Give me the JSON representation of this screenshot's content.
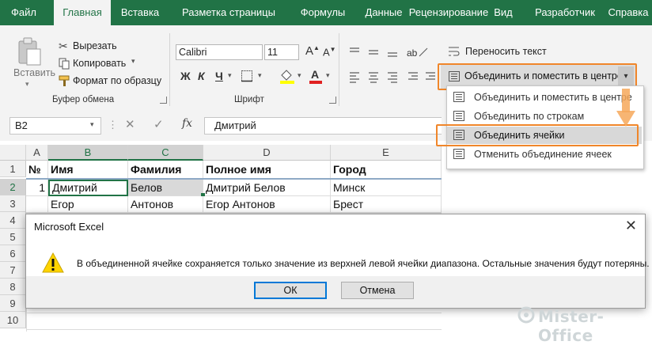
{
  "ribbon": {
    "tabs": [
      "Файл",
      "Главная",
      "Вставка",
      "Разметка страницы",
      "Формулы",
      "Данные",
      "Рецензирование",
      "Вид",
      "Разработчик",
      "Справка"
    ],
    "clipboard": {
      "paste": "Вставить",
      "cut": "Вырезать",
      "copy": "Копировать",
      "format_painter": "Формат по образцу",
      "group_label": "Буфер обмена"
    },
    "font": {
      "name": "Calibri",
      "size": "11",
      "bold": "Ж",
      "italic": "К",
      "underline": "Ч",
      "group_label": "Шрифт"
    },
    "alignment": {
      "wrap_text": "Переносить текст",
      "merge_center": "Объединить и поместить в центре"
    }
  },
  "merge_menu": {
    "items": [
      "Объединить и поместить в центре",
      "Объединить по строкам",
      "Объединить ячейки",
      "Отменить объединение ячеек"
    ]
  },
  "formula_bar": {
    "name_box": "B2",
    "fx": "fx",
    "value": "Дмитрий"
  },
  "sheet": {
    "columns": [
      "A",
      "B",
      "C",
      "D",
      "E"
    ],
    "row_numbers": [
      "1",
      "2",
      "3",
      "4",
      "5",
      "6",
      "7",
      "8",
      "9",
      "10"
    ],
    "header_row": [
      "№",
      "Имя",
      "Фамилия",
      "Полное имя",
      "Город"
    ],
    "rows": [
      [
        "1",
        "Дмитрий",
        "Белов",
        "Дмитрий Белов",
        "Минск"
      ],
      [
        "",
        "Егор",
        "Антонов",
        "Егор Антонов",
        "Брест"
      ]
    ]
  },
  "dialog": {
    "title": "Microsoft Excel",
    "message": "В объединенной ячейке сохраняется только значение из верхней левой ячейки диапазона. Остальные значения будут потеряны.",
    "ok": "ОК",
    "cancel": "Отмена"
  },
  "watermark": "Mister-Office",
  "colors": {
    "excel_green": "#217346",
    "highlight_orange": "#f0862a",
    "selection_fill": "#d9d9d9"
  }
}
